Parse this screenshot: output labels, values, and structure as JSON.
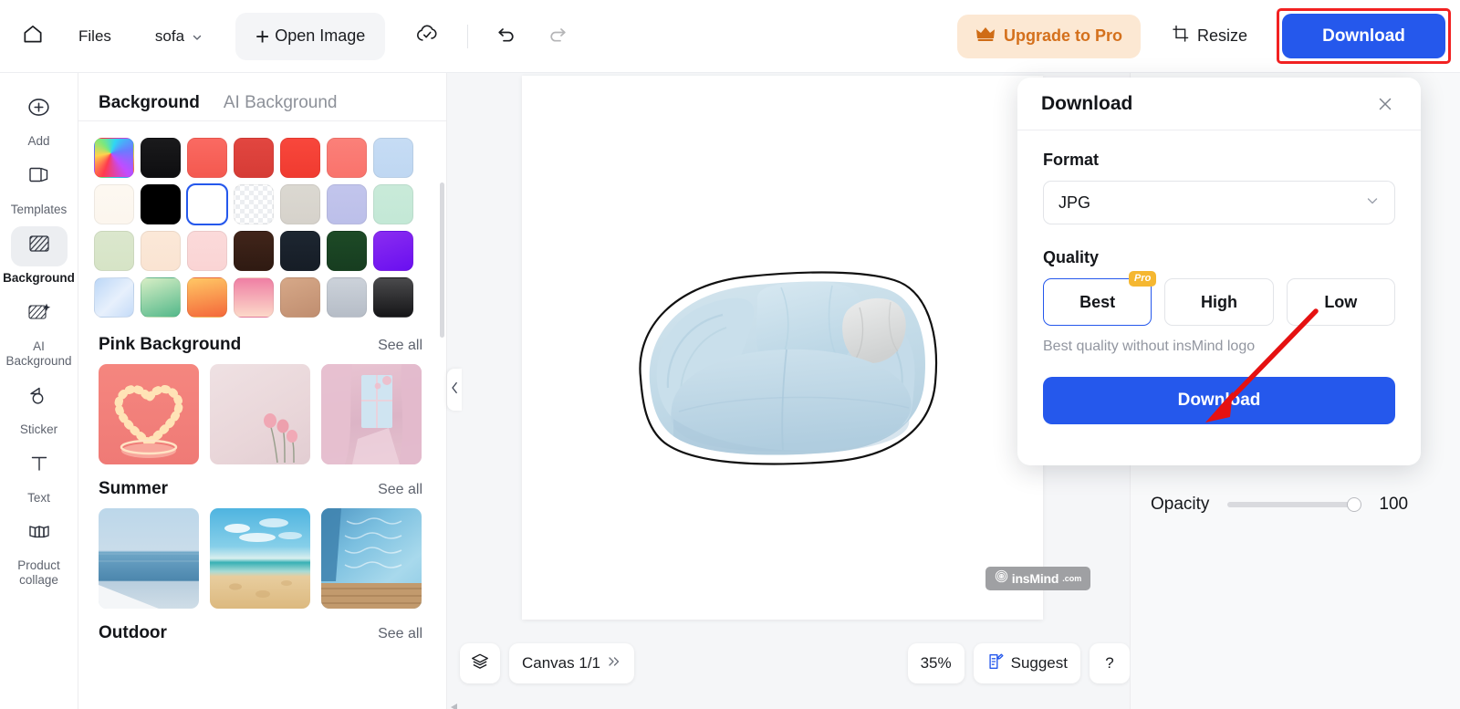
{
  "topbar": {
    "home_icon": "home-icon",
    "files_label": "Files",
    "file_name": "sofa",
    "open_image_label": "Open Image",
    "open_image_plus": "+",
    "cloud_icon": "cloud-sync-icon",
    "undo_icon": "undo-icon",
    "redo_icon": "redo-icon",
    "upgrade_label": "Upgrade to Pro",
    "upgrade_icon": "crown-icon",
    "resize_label": "Resize",
    "resize_icon": "crop-icon",
    "download_label": "Download",
    "accent_blue": "#2558ec",
    "upgrade_bg": "#fce8d3",
    "upgrade_fg": "#d4701c",
    "highlight_red": "#f22121"
  },
  "rail": {
    "items": [
      {
        "label": "Add",
        "icon": "plus-circle-icon",
        "active": false
      },
      {
        "label": "Templates",
        "icon": "templates-icon",
        "active": false
      },
      {
        "label": "Background",
        "icon": "background-hatch-icon",
        "active": true
      },
      {
        "label": "AI Background",
        "icon": "ai-background-icon",
        "active": false
      },
      {
        "label": "Sticker",
        "icon": "sticker-icon",
        "active": false
      },
      {
        "label": "Text",
        "icon": "text-icon",
        "active": false
      },
      {
        "label": "Product collage",
        "icon": "collage-icon",
        "active": false
      }
    ]
  },
  "panel": {
    "tabs": [
      {
        "label": "Background",
        "active": true
      },
      {
        "label": "AI Background",
        "active": false
      }
    ],
    "swatches": [
      [
        {
          "name": "rainbow-gradient",
          "css": "conic-gradient(from 200deg at 42% 38%, #ff3b4e, #ffd34d, #7ee87a, #2fd6f3, #6a7bff, #c14cff, #ff3b4e)"
        },
        {
          "name": "near-black",
          "css": "linear-gradient(180deg,#1a1a1c,#0e0e10)"
        },
        {
          "name": "coral-red",
          "css": "linear-gradient(180deg,#fa6a62,#f4594f)"
        },
        {
          "name": "crimson",
          "css": "linear-gradient(180deg,#e24640,#d63c36)"
        },
        {
          "name": "bright-red",
          "css": "linear-gradient(180deg,#f8473c,#f03b30)"
        },
        {
          "name": "salmon",
          "css": "linear-gradient(180deg,#fb8079,#f9736c)"
        },
        {
          "name": "light-blue",
          "css": "linear-gradient(180deg,#c6dcf4,#bfd7f2)"
        }
      ],
      [
        {
          "name": "ivory",
          "css": "linear-gradient(180deg,#fdf8f1,#fcf6ee)"
        },
        {
          "name": "black",
          "css": "#000000"
        },
        {
          "name": "white",
          "css": "#ffffff",
          "selected": true
        },
        {
          "name": "transparent-checker",
          "css": "checker"
        },
        {
          "name": "warm-gray",
          "css": "linear-gradient(180deg,#dbd8d1,#d6d2cb)"
        },
        {
          "name": "periwinkle",
          "css": "linear-gradient(180deg,#c2c5ec,#bcbfe9)"
        },
        {
          "name": "mint",
          "css": "linear-gradient(180deg,#c9ead9,#c3e8d6)"
        }
      ],
      [
        {
          "name": "sage-green",
          "css": "linear-gradient(180deg,#dbe7cd,#d6e4c6)"
        },
        {
          "name": "peach-cream",
          "css": "linear-gradient(180deg,#fbe8d8,#fae4d2)"
        },
        {
          "name": "blush-pink",
          "css": "linear-gradient(180deg,#fbdada,#fad4d4)"
        },
        {
          "name": "dark-brown",
          "css": "linear-gradient(180deg,#41251a,#2f1a12)"
        },
        {
          "name": "midnight-navy",
          "css": "linear-gradient(180deg,#1d2631,#161d26)"
        },
        {
          "name": "forest-green",
          "css": "linear-gradient(180deg,#1d4a26,#173d20)"
        },
        {
          "name": "violet",
          "css": "linear-gradient(160deg,#8a2df0,#6a0ff0)"
        }
      ],
      [
        {
          "name": "sky-gradient",
          "css": "linear-gradient(135deg,#bcd7f7,#e7f0fc 55%,#c4dbf8)"
        },
        {
          "name": "green-gradient",
          "css": "linear-gradient(160deg,#d7eec5,#53b88a)"
        },
        {
          "name": "orange-gradient",
          "css": "linear-gradient(170deg,#ffc765,#f4683a)"
        },
        {
          "name": "pink-gradient",
          "css": "linear-gradient(180deg,#ef7fa4,#fcd9c9)"
        },
        {
          "name": "tan-gradient",
          "css": "linear-gradient(160deg,#d6a888,#c08e70)"
        },
        {
          "name": "silver-gradient",
          "css": "linear-gradient(180deg,#ccd2da,#b6bdc7)"
        },
        {
          "name": "charcoal-gradient",
          "css": "linear-gradient(180deg,#4a4a4c,#161618)"
        }
      ]
    ],
    "sections": [
      {
        "title": "Pink Background",
        "see_all": "See all",
        "thumbs": [
          {
            "name": "pink-heart-neon-podium"
          },
          {
            "name": "pink-wall-with-roses"
          },
          {
            "name": "pink-curtain-window"
          }
        ]
      },
      {
        "title": "Summer",
        "see_all": "See all",
        "thumbs": [
          {
            "name": "calm-sea-horizon"
          },
          {
            "name": "beach-sand-clouds"
          },
          {
            "name": "pool-water-deck"
          }
        ]
      },
      {
        "title": "Outdoor",
        "see_all": "See all",
        "thumbs": []
      }
    ]
  },
  "canvas": {
    "watermark_text": "insMind",
    "watermark_domain": ".com",
    "collapse_icon": "chevron-left-icon"
  },
  "bottombar": {
    "layers_icon": "layers-icon",
    "canvas_label": "Canvas 1/1",
    "canvas_expand_icon": "double-chevron-right-icon",
    "zoom_label": "35%",
    "suggest_label": "Suggest",
    "suggest_icon": "suggest-note-icon",
    "help_label": "?"
  },
  "rightpanel": {
    "opacity_label": "Opacity",
    "opacity_value": "100"
  },
  "download_dialog": {
    "title": "Download",
    "close_icon": "close-icon",
    "format_label": "Format",
    "format_value": "JPG",
    "format_chevron": "chevron-down-icon",
    "quality_label": "Quality",
    "quality_options": [
      {
        "label": "Best",
        "selected": true,
        "badge": "Pro"
      },
      {
        "label": "High",
        "selected": false,
        "badge": ""
      },
      {
        "label": "Low",
        "selected": false,
        "badge": ""
      }
    ],
    "quality_hint": "Best quality without insMind logo",
    "download_label": "Download",
    "annotation_arrow": "red-arrow-pointing-to-download-button"
  }
}
